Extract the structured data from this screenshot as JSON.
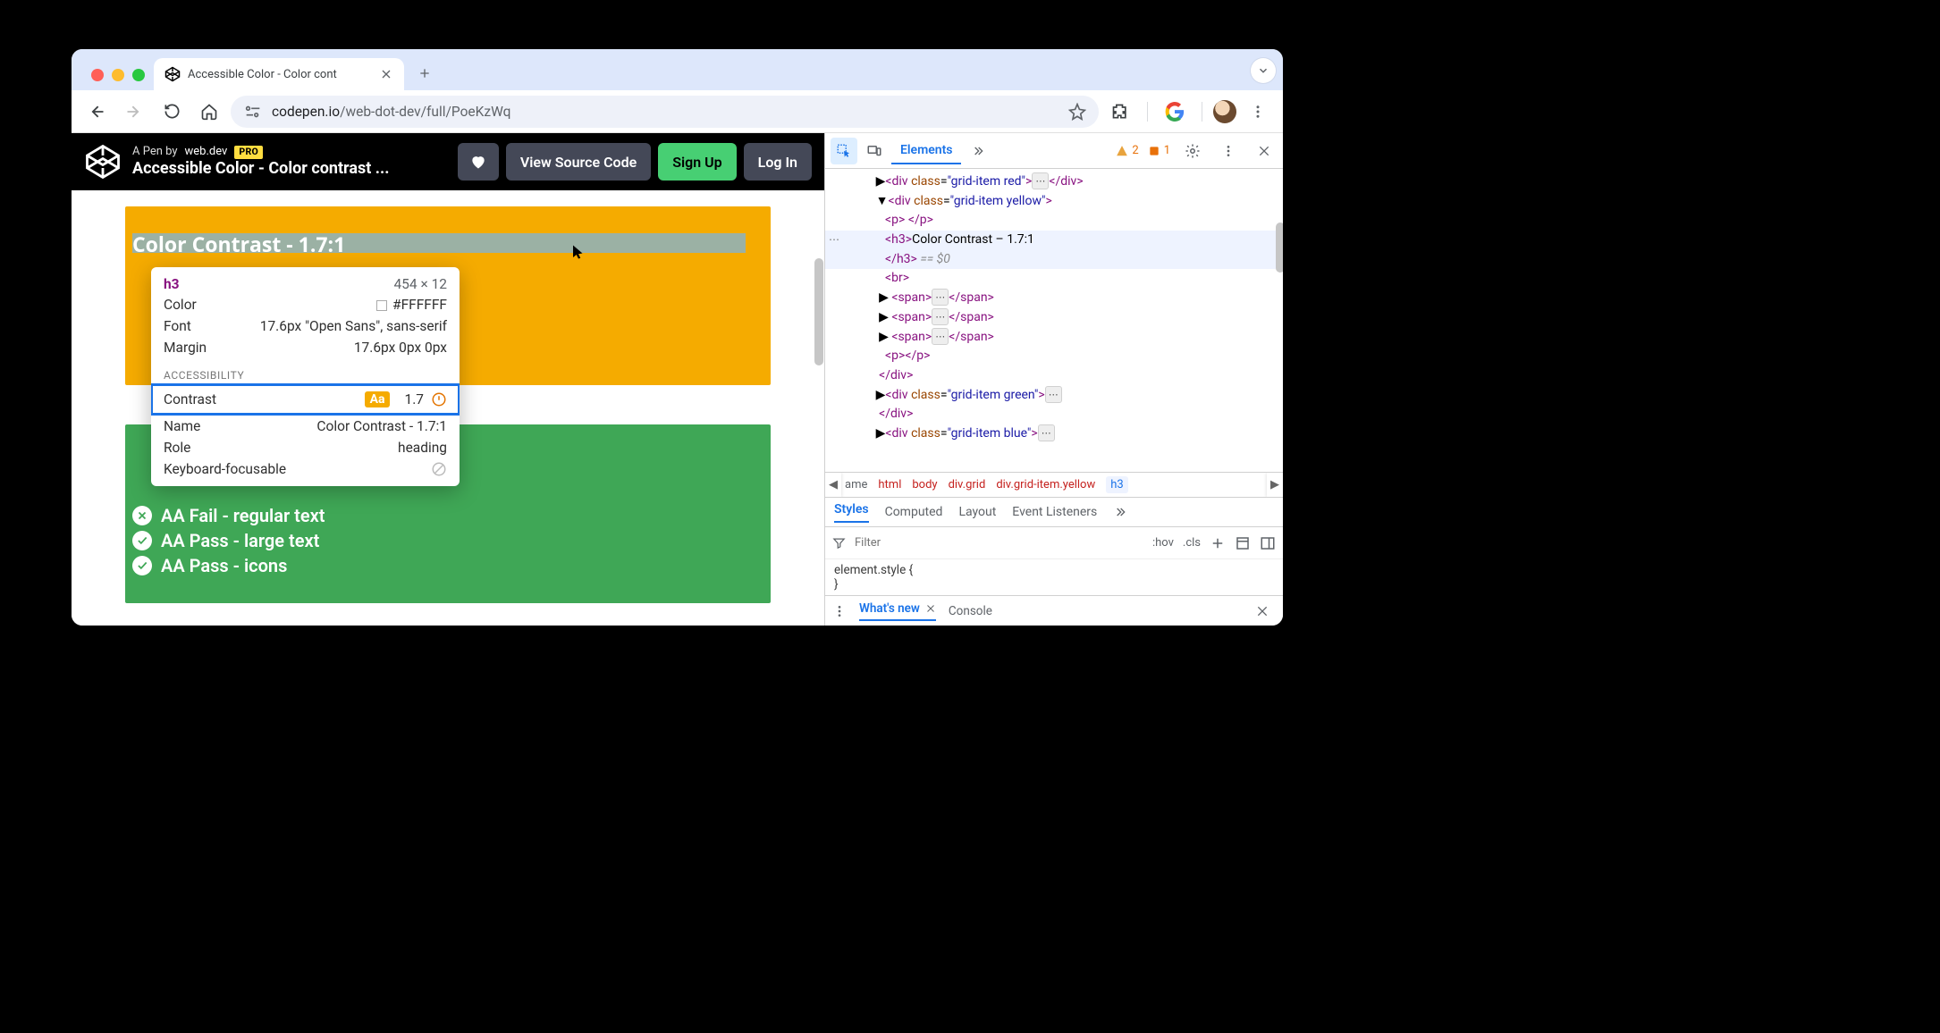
{
  "browser": {
    "tab_title": "Accessible Color - Color cont",
    "url_host": "codepen.io",
    "url_path": "/web-dot-dev/full/PoeKzWq"
  },
  "codepen": {
    "byline_prefix": "A Pen by",
    "byline_author": "web.dev",
    "pro_badge": "PRO",
    "title": "Accessible Color - Color contrast ...",
    "buttons": {
      "view_source": "View Source Code",
      "sign_up": "Sign Up",
      "log_in": "Log In"
    }
  },
  "page": {
    "yellow_heading": "Color Contrast - 1.7:1",
    "green_checks": [
      {
        "status": "fail",
        "label": "AA Fail - regular text"
      },
      {
        "status": "pass",
        "label": "AA Pass - large text"
      },
      {
        "status": "pass",
        "label": "AA Pass - icons"
      }
    ]
  },
  "tooltip": {
    "tag": "h3",
    "dimensions": "454 × 12",
    "rows": {
      "color_label": "Color",
      "color_value": "#FFFFFF",
      "font_label": "Font",
      "font_value": "17.6px \"Open Sans\", sans-serif",
      "margin_label": "Margin",
      "margin_value": "17.6px 0px 0px"
    },
    "accessibility_label": "ACCESSIBILITY",
    "contrast_label": "Contrast",
    "contrast_badge": "Aa",
    "contrast_value": "1.7",
    "name_label": "Name",
    "name_value": "Color Contrast - 1.7:1",
    "role_label": "Role",
    "role_value": "heading",
    "kbd_label": "Keyboard-focusable"
  },
  "devtools": {
    "tabs": {
      "elements": "Elements"
    },
    "issues": {
      "warn": "2",
      "err": "1"
    },
    "dom_h3_text": "Color Contrast – 1.7:1",
    "eq0": "== $0",
    "crumbs": [
      "ame",
      "html",
      "body",
      "div.grid",
      "div.grid-item.yellow",
      "h3"
    ],
    "styles_tabs": [
      "Styles",
      "Computed",
      "Layout",
      "Event Listeners"
    ],
    "filter_placeholder": "Filter",
    "hov": ":hov",
    "cls": ".cls",
    "rule_line1": "element.style {",
    "rule_line2": "}",
    "drawer": {
      "whatsnew": "What's new",
      "console": "Console"
    }
  }
}
